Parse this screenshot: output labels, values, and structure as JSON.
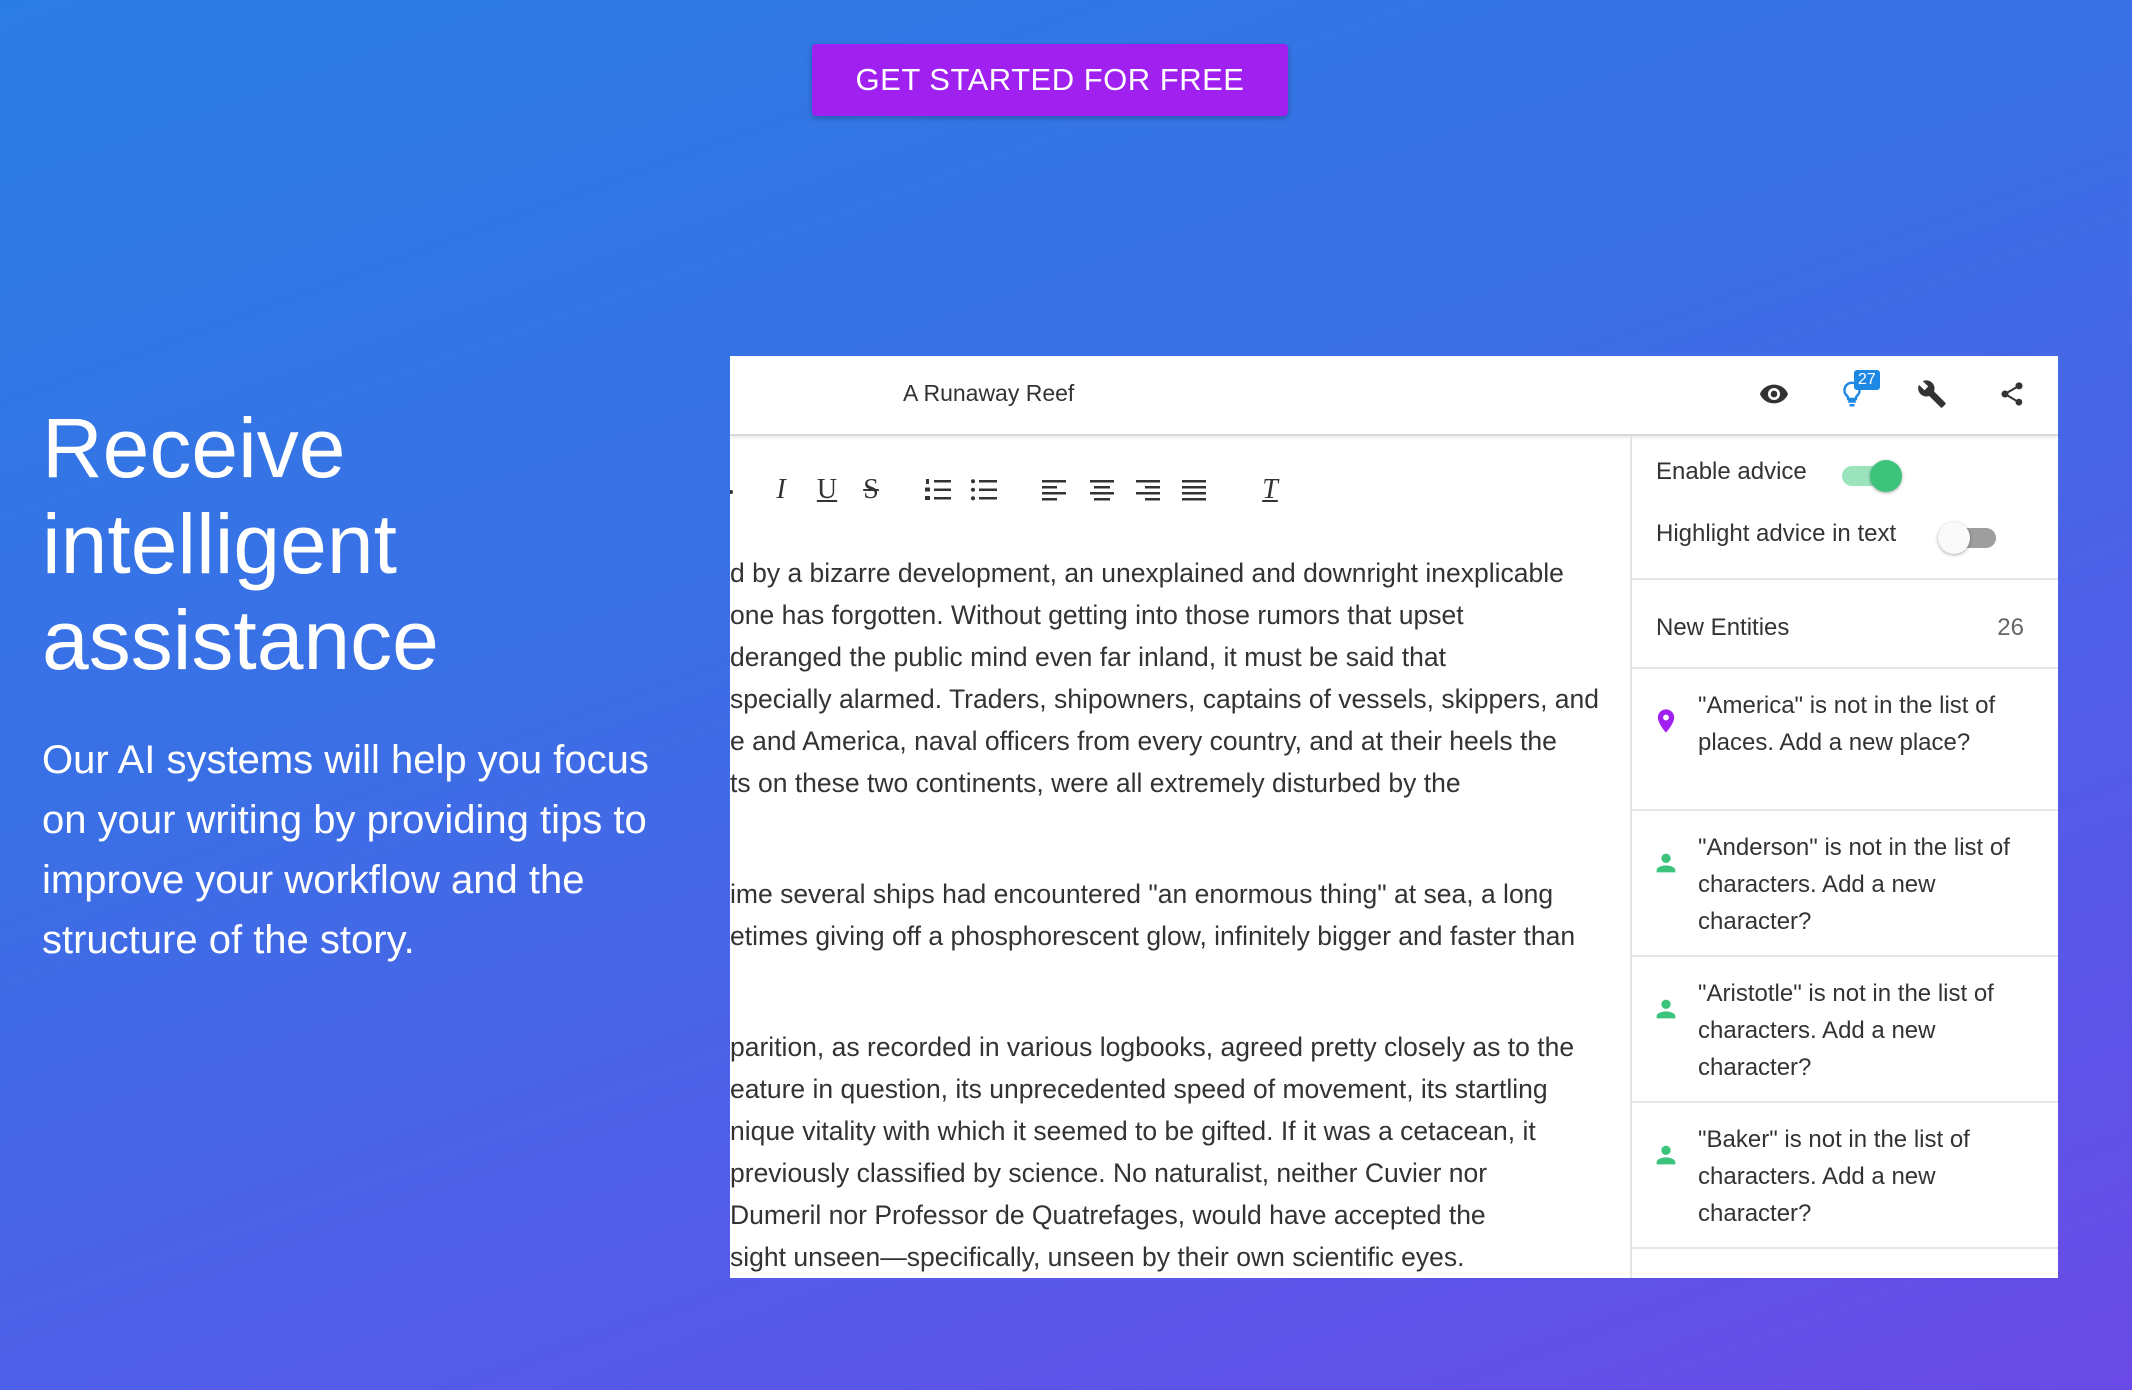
{
  "cta": {
    "label": "GET STARTED FOR FREE"
  },
  "hero": {
    "title_lines": [
      "Receive",
      "intelligent",
      "assistance"
    ],
    "description_lines": [
      "Our AI systems will help you focus",
      "on your writing by providing tips to",
      "improve your workflow and the",
      "structure of the story."
    ]
  },
  "app": {
    "doc_title": "A Runaway Reef",
    "header_icons": {
      "preview": "eye-icon",
      "advice": "lightbulb-icon",
      "advice_badge": "27",
      "tools": "wrench-icon",
      "share": "share-icon"
    },
    "toolbar": {
      "buttons": [
        "italic",
        "underline",
        "strikethrough",
        "ordered-list",
        "bulleted-list",
        "align-left",
        "align-center",
        "align-right",
        "align-justify",
        "clear-formatting"
      ],
      "italic_glyph": "I",
      "underline_glyph": "U",
      "strike_glyph": "S",
      "clear_glyph": "T"
    },
    "editor": {
      "paragraphs": [
        [
          "d by a bizarre development, an unexplained and downright inexplicable",
          "one has forgotten. Without getting into those rumors that upset",
          "deranged the public mind even far inland, it must be said that",
          "specially alarmed. Traders, shipowners, captains of vessels, skippers, and",
          "e and America, naval officers from every country, and at their heels the",
          "ts on these two continents, were all extremely disturbed by the"
        ],
        [
          "ime several ships had encountered \"an enormous thing\" at sea, a long",
          "etimes giving off a phosphorescent glow, infinitely bigger and faster than"
        ],
        [
          "parition, as recorded in various logbooks, agreed pretty closely as to the",
          "eature in question, its unprecedented speed of movement, its startling",
          "nique vitality with which it seemed to be gifted. If it was a cetacean, it",
          "previously classified by science. No naturalist, neither Cuvier nor",
          " Dumeril nor Professor de Quatrefages, would have accepted the",
          "sight unseen—specifically, unseen by their own scientific eyes."
        ]
      ]
    },
    "sidebar": {
      "enable_advice": {
        "label": "Enable advice",
        "on": true
      },
      "highlight_advice": {
        "label": "Highlight advice in text",
        "on": false
      },
      "new_entities": {
        "label": "New Entities",
        "count": "26"
      },
      "entities": [
        {
          "icon": "map-pin-icon",
          "color": "#a020f0",
          "lines": [
            "\"America\" is not in the list of",
            "places. Add a new place?"
          ]
        },
        {
          "icon": "person-icon",
          "color": "#3cc47c",
          "lines": [
            "\"Anderson\" is not in the list of",
            "characters. Add a new",
            "character?"
          ]
        },
        {
          "icon": "person-icon",
          "color": "#3cc47c",
          "lines": [
            "\"Aristotle\" is not in the list of",
            "characters. Add a new",
            "character?"
          ]
        },
        {
          "icon": "person-icon",
          "color": "#3cc47c",
          "lines": [
            "\"Baker\" is not in the list of",
            "characters. Add a new",
            "character?"
          ]
        }
      ]
    },
    "colors": {
      "cta": "#a020f0",
      "toggle_on_track": "#9be3bd",
      "toggle_on_knob": "#3cc47c",
      "badge": "#1e88e5"
    }
  }
}
